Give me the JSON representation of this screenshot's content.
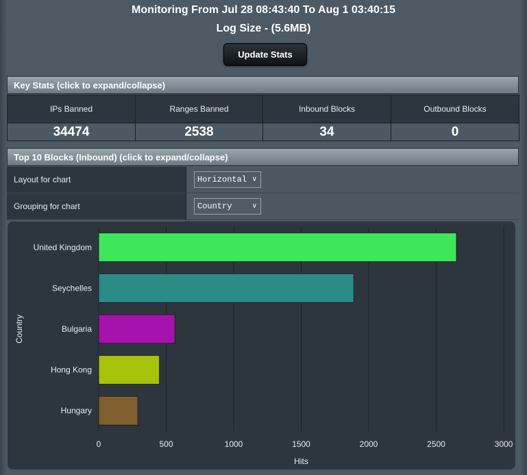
{
  "header": {
    "monitoring": "Monitoring From Jul 28 08:43:40 To Aug 1 03:40:15",
    "log_size": "Log Size - (5.6MB)",
    "update_button": "Update Stats"
  },
  "key_stats": {
    "title": "Key Stats (click to expand/collapse)",
    "items": [
      {
        "label": "IPs Banned",
        "value": "34474"
      },
      {
        "label": "Ranges Banned",
        "value": "2538"
      },
      {
        "label": "Inbound Blocks",
        "value": "34"
      },
      {
        "label": "Outbound Blocks",
        "value": "0"
      }
    ]
  },
  "top_blocks": {
    "title": "Top 10 Blocks (Inbound) (click to expand/collapse)",
    "layout_label": "Layout for chart",
    "layout_value": "Horizontal",
    "grouping_label": "Grouping for chart",
    "grouping_value": "Country"
  },
  "colors": {
    "united_kingdom": "#3ee65a",
    "seychelles": "#2b8c86",
    "bulgaria": "#a512ad",
    "hong_kong": "#a6c20b",
    "hungary": "#7f5f2e"
  },
  "chart_data": {
    "type": "bar",
    "orientation": "horizontal",
    "categories": [
      "United Kingdom",
      "Seychelles",
      "Bulgaria",
      "Hong Kong",
      "Hungary"
    ],
    "values": [
      2650,
      1890,
      565,
      450,
      290
    ],
    "bar_colors": [
      "#3ee65a",
      "#2b8c86",
      "#a512ad",
      "#a6c20b",
      "#7f5f2e"
    ],
    "xlabel": "Hits",
    "ylabel": "Country",
    "xlim": [
      0,
      3000
    ],
    "xticks": [
      0,
      500,
      1000,
      1500,
      2000,
      2500,
      3000
    ],
    "grid": "vertical"
  }
}
